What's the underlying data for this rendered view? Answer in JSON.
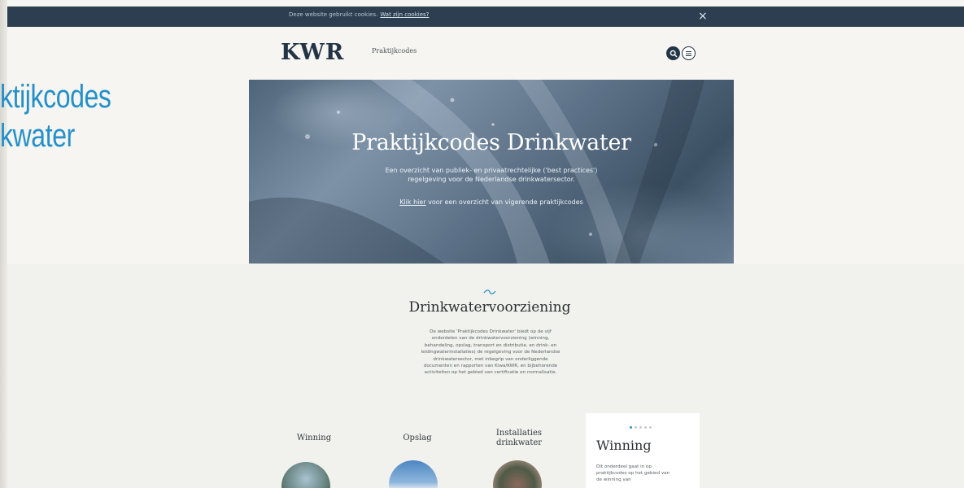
{
  "cookie_bar": {
    "text": "Deze website gebruikt cookies.",
    "link": "Wat zijn cookies?",
    "close": "×"
  },
  "side_title": {
    "line1": "ktijkcodes",
    "line2": "kwater"
  },
  "header": {
    "logo": "KWR",
    "subtitle": "Praktijkcodes",
    "icons": [
      "search-icon",
      "menu-icon"
    ]
  },
  "hero": {
    "title": "Praktijkcodes Drinkwater",
    "description_lines": [
      "Een overzicht van publiek- en privaatrechtelijke ('best practices')",
      "regelgeving voor de Nederlandse drinkwatersector."
    ],
    "link_text": "Klik hier",
    "link_suffix": " voor een overzicht van vigerende praktijkcodes"
  },
  "section": {
    "icon": "wave-icon",
    "title": "Drinkwatervoorziening",
    "text_lines": [
      "De website 'Praktijkcodes Drinkwater' biedt op de vijf",
      "onderdelen van de drinkwatervoorziening (winning,",
      "behandeling, opslag, transport en distributie, en drink- en",
      "leidingwaterinstallaties) de regelgeving voor de Nederlandse",
      "drinkwatersector, met inbegrip van onderliggende",
      "documenten en rapporten van Kiwa/KWR, en bijbehorende",
      "activiteiten op het gebied van certificatie en normalisatie."
    ]
  },
  "categories": [
    {
      "lines": [
        "Winning"
      ]
    },
    {
      "lines": [
        "Opslag"
      ]
    },
    {
      "lines": [
        "Installaties",
        "drinkwater"
      ]
    }
  ],
  "panel": {
    "title": "Winning",
    "text_lines": [
      "Dit onderdeel gaat in op",
      "praktijkcodes op het gebied van",
      "de winning van"
    ]
  },
  "colors": {
    "accent": "#2490c9",
    "cookie_bar": "#2c3e4f",
    "logo": "#233447"
  }
}
